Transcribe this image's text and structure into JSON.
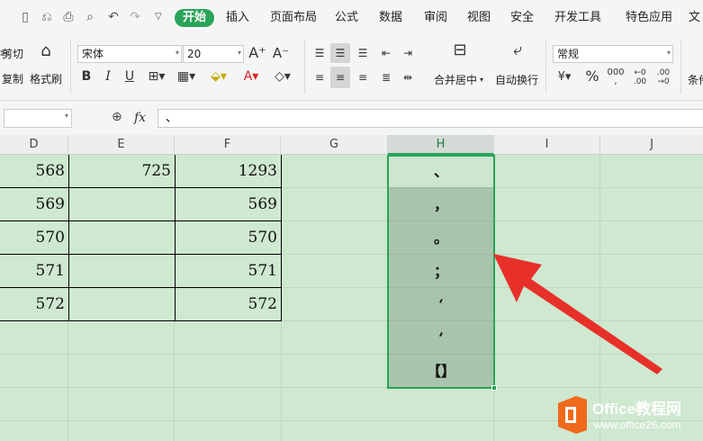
{
  "menu": {
    "tabs": [
      {
        "label": "开始",
        "active": true
      },
      {
        "label": "插入"
      },
      {
        "label": "页面布局"
      },
      {
        "label": "公式"
      },
      {
        "label": "数据"
      },
      {
        "label": "审阅"
      },
      {
        "label": "视图"
      },
      {
        "label": "安全"
      },
      {
        "label": "开发工具"
      },
      {
        "label": "特色应用"
      },
      {
        "label": "文"
      }
    ],
    "accent_color": "#2aa35a"
  },
  "ribbon": {
    "cut_label": "剪切",
    "copy_label": "复制",
    "format_painter_label": "格式刷",
    "font_name": "宋体",
    "font_size": "20",
    "merge_label": "合并居中",
    "wrap_label": "自动换行",
    "number_format": "常规",
    "cond_label": "条件"
  },
  "formula_bar": {
    "fx_label": "fx",
    "value": "、"
  },
  "columns": [
    "D",
    "E",
    "F",
    "G",
    "H",
    "I",
    "J"
  ],
  "selected_column": "H",
  "table": {
    "rows": [
      {
        "d": "568",
        "e": "725",
        "f": "1293"
      },
      {
        "d": "569",
        "e": "",
        "f": "569"
      },
      {
        "d": "570",
        "e": "",
        "f": "570"
      },
      {
        "d": "571",
        "e": "",
        "f": "571"
      },
      {
        "d": "572",
        "e": "",
        "f": "572"
      }
    ]
  },
  "h_column": [
    "、",
    "，",
    "。",
    "；",
    "‘",
    "’",
    "【】"
  ],
  "watermark": {
    "brand": "Office教程网",
    "url": "www.office26.com"
  },
  "colors": {
    "arrow": "#e8302a",
    "logo_orange": "#f06a1c",
    "selection_green": "#2aa35a"
  }
}
